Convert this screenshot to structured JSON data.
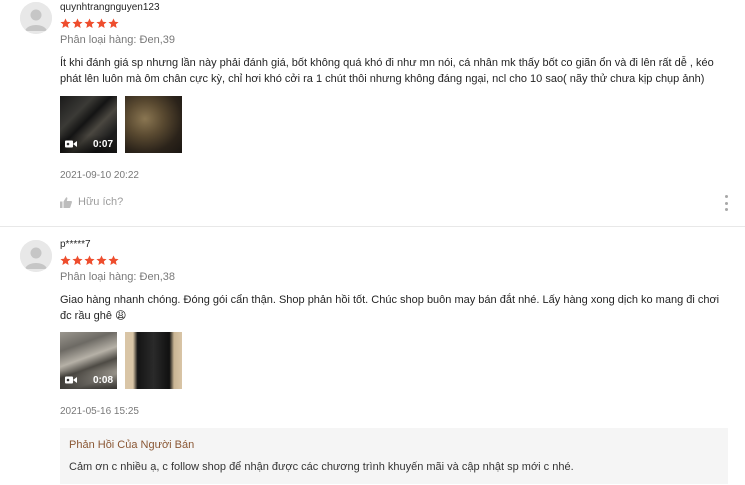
{
  "colors": {
    "star": "#ee4d2d",
    "reply_title": "#8a5734",
    "muted": "rgba(0,0,0,0.54)"
  },
  "reviews": [
    {
      "username": "quynhtrangnguyen123",
      "rating": 5,
      "variation": "Phân loại hàng: Đen,39",
      "content": "Ít khi đánh giá sp nhưng lần này phải đánh giá, bốt không quá khó đi như mn nói, cá nhân mk thấy bốt co giãn ổn và đi lên rất dễ , kéo phát lên luôn mà ôm chân cực kỳ, chỉ hơi khó cởi ra 1 chút thôi nhưng không đáng ngại, ncl cho 10 sao( nãy thử chưa kịp chụp ảnh)",
      "media": [
        {
          "type": "video",
          "icon": "video-camera-icon",
          "duration": "0:07"
        },
        {
          "type": "image"
        }
      ],
      "time": "2021-09-10 20:22",
      "like_label": "Hữu ích?",
      "like_icon": "thumbs-up-icon",
      "more_icon": "more-vertical-icon"
    },
    {
      "username": "p*****7",
      "rating": 5,
      "variation": "Phân loại hàng: Đen,38",
      "content": "Giao hàng nhanh chóng. Đóng gói cẩn thận. Shop phản hồi tốt. Chúc shop buôn may bán đắt nhé. Lấy hàng xong dịch ko mang đi chơi đc rầu ghê 😩",
      "media": [
        {
          "type": "video",
          "icon": "video-camera-icon",
          "duration": "0:08"
        },
        {
          "type": "image"
        }
      ],
      "time": "2021-05-16 15:25",
      "seller_reply": {
        "title": "Phản Hồi Của Người Bán",
        "text": "Cảm ơn c nhiều ạ, c follow shop để nhận được các chương trình khuyến mãi và cập nhật sp mới c nhé."
      }
    }
  ]
}
